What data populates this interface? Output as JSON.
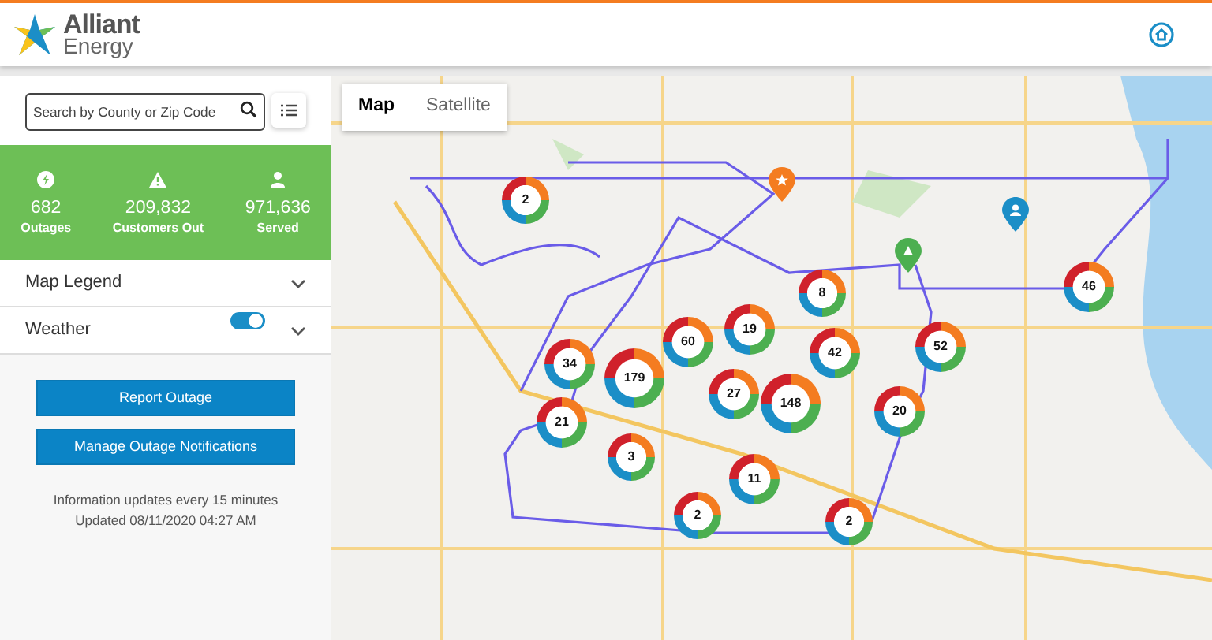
{
  "header": {
    "logo_name": "Alliant",
    "logo_sub": "Energy"
  },
  "sidebar": {
    "search": {
      "placeholder": "Search by County or Zip Code"
    },
    "stats": [
      {
        "kind": "outages",
        "value": "682",
        "label": "Outages"
      },
      {
        "kind": "customers",
        "value": "209,832",
        "label": "Customers Out"
      },
      {
        "kind": "served",
        "value": "971,636",
        "label": "Served"
      }
    ],
    "sections": [
      {
        "label": "Map Legend",
        "kind": "plain"
      },
      {
        "label": "Weather",
        "kind": "toggle",
        "on": true
      }
    ],
    "buttons": [
      "Report Outage",
      "Manage Outage Notifications"
    ],
    "info": [
      "Information updates every 15 minutes",
      "Updated 08/11/2020 04:27 AM"
    ]
  },
  "map": {
    "tabs": [
      {
        "label": "Map",
        "selected": true
      },
      {
        "label": "Satellite",
        "selected": false
      }
    ],
    "clusters": [
      "2",
      "34",
      "179",
      "60",
      "19",
      "8",
      "42",
      "52",
      "27",
      "148",
      "20",
      "21",
      "3",
      "11",
      "2",
      "2",
      "46"
    ],
    "pins": [
      {
        "kind": "star",
        "color": "#f47c20"
      },
      {
        "kind": "triangle",
        "color": "#4caf50"
      },
      {
        "kind": "person",
        "color": "#1b8ec7"
      }
    ]
  }
}
